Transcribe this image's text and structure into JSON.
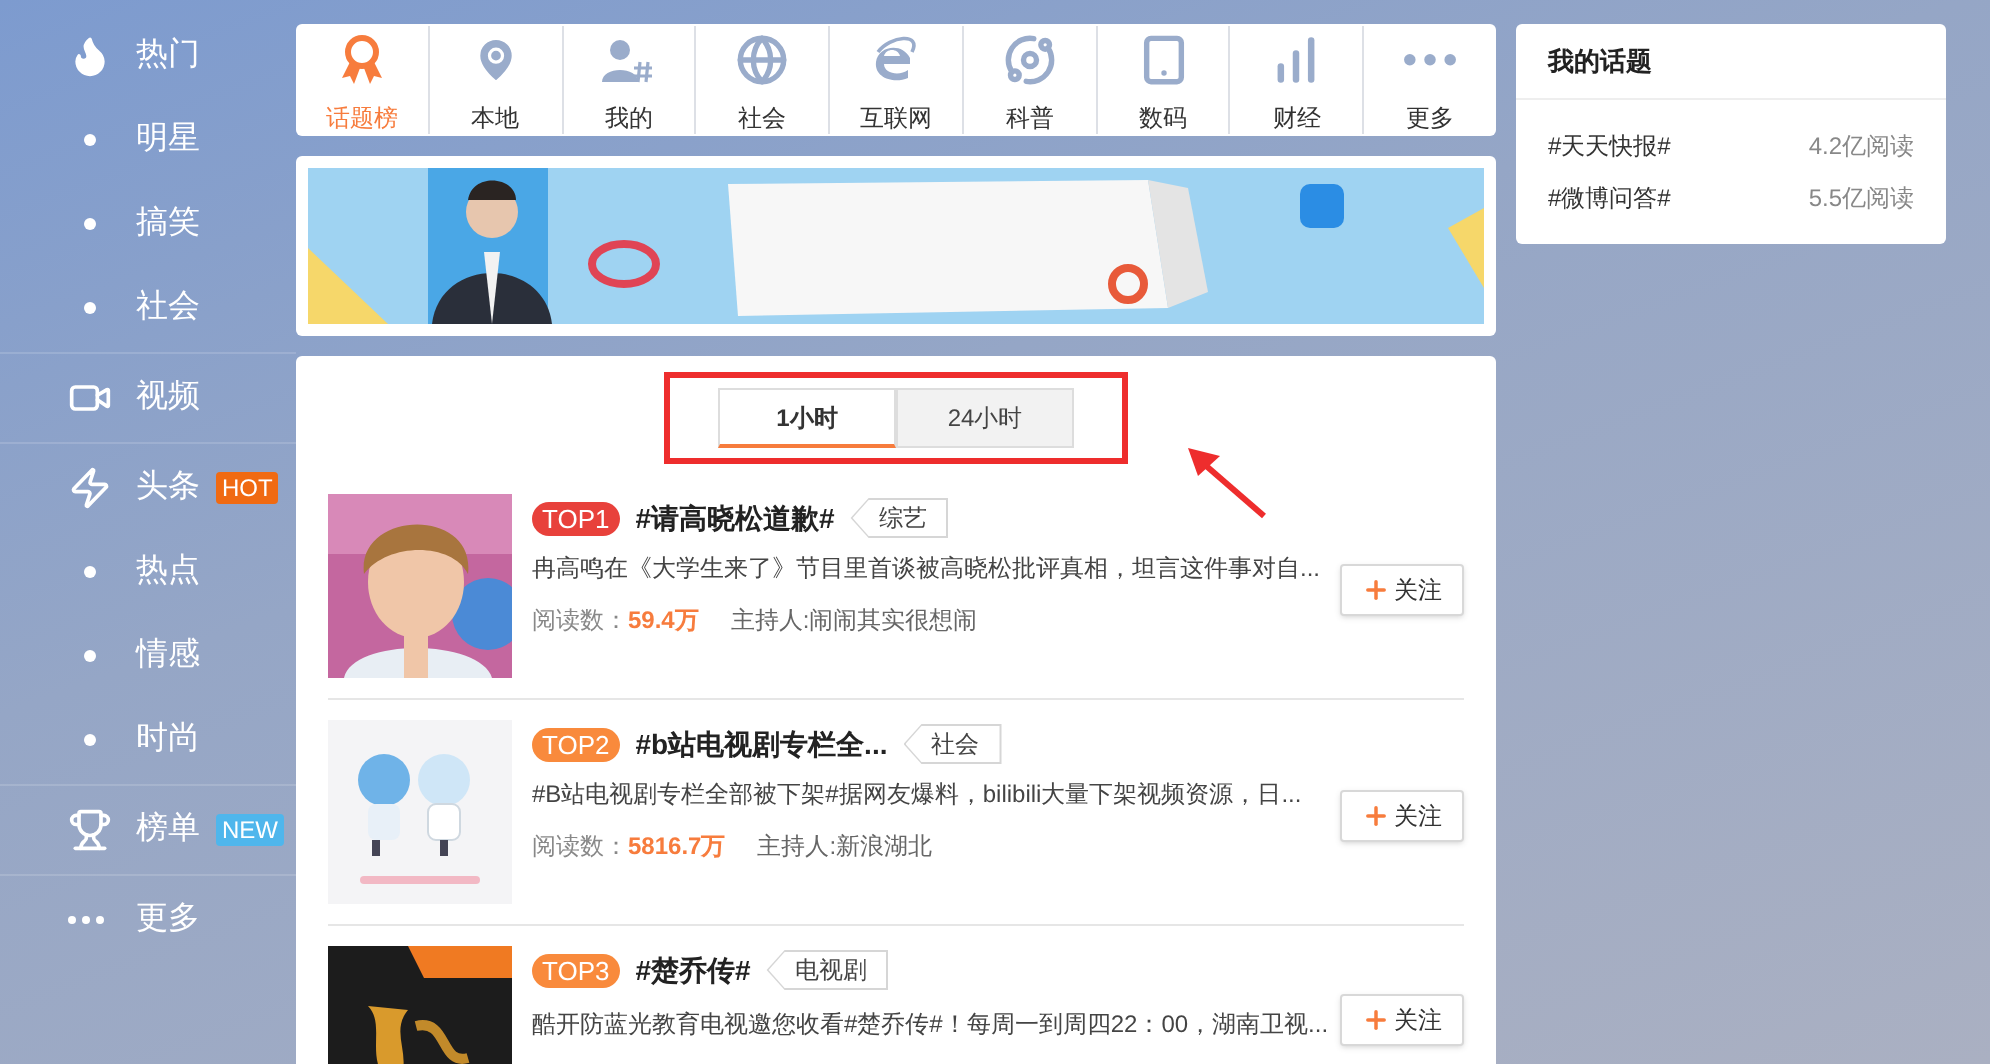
{
  "sidebar": {
    "groups": [
      {
        "label": "热门",
        "children": [
          {
            "label": "明星"
          },
          {
            "label": "搞笑"
          },
          {
            "label": "社会"
          }
        ]
      },
      {
        "label": "视频"
      },
      {
        "label": "头条",
        "badge": {
          "text": "HOT",
          "color": "#f06a12"
        },
        "children": [
          {
            "label": "热点"
          },
          {
            "label": "情感"
          },
          {
            "label": "时尚"
          }
        ]
      },
      {
        "label": "榜单",
        "badge": {
          "text": "NEW",
          "color": "#4fb6ec"
        }
      },
      {
        "label": "更多"
      }
    ]
  },
  "nav": [
    {
      "label": "话题榜",
      "selected": true
    },
    {
      "label": "本地",
      "selected": false
    },
    {
      "label": "我的",
      "selected": false
    },
    {
      "label": "社会",
      "selected": false
    },
    {
      "label": "互联网",
      "selected": false
    },
    {
      "label": "科普",
      "selected": false
    },
    {
      "label": "数码",
      "selected": false
    },
    {
      "label": "财经",
      "selected": false
    },
    {
      "label": "更多",
      "selected": false
    }
  ],
  "time_tabs": [
    {
      "label": "1小时",
      "selected": true
    },
    {
      "label": "24小时",
      "selected": false
    }
  ],
  "topics": [
    {
      "rank": "TOP1",
      "color": "#e8413b",
      "title": "#请高晓松道歉#",
      "tag": "综艺",
      "description": "冉高鸣在《大学生来了》节目里首谈被高晓松批评真相，坦言这件事对自...",
      "reads_label": "阅读数：",
      "reads": "59.4万",
      "host": "主持人:闹闹其实很想闹",
      "follow": "关注"
    },
    {
      "rank": "TOP2",
      "color": "#f98a3c",
      "title": "#b站电视剧专栏全...",
      "tag": "社会",
      "description": "#B站电视剧专栏全部被下架#据网友爆料，bilibili大量下架视频资源，日...",
      "reads_label": "阅读数：",
      "reads": "5816.7万",
      "host": "主持人:新浪湖北",
      "follow": "关注"
    },
    {
      "rank": "TOP3",
      "color": "#f98a3c",
      "title": "#楚乔传#",
      "tag": "电视剧",
      "description": "酷开防蓝光教育电视邀您收看#楚乔传#！每周一到周四22：00，湖南卫视...",
      "follow": "关注"
    }
  ],
  "my_topics": {
    "title": "我的话题",
    "items": [
      {
        "name": "#天天快报#",
        "reads": "4.2亿阅读"
      },
      {
        "name": "#微博问答#",
        "reads": "5.5亿阅读"
      }
    ]
  }
}
